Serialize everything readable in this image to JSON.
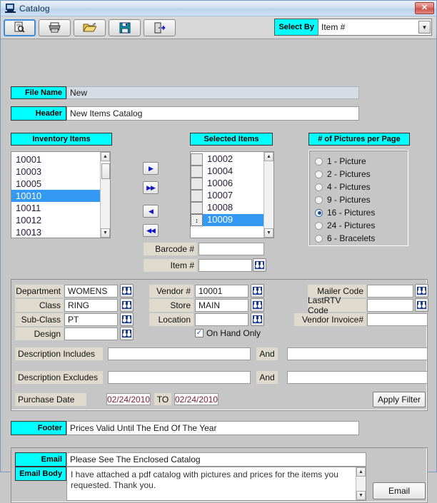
{
  "window": {
    "title": "Catalog",
    "icon": "computer-icon",
    "close_label": "✕"
  },
  "toolbar": {
    "buttons": [
      {
        "name": "print-preview-button",
        "icon": "print-preview-icon"
      },
      {
        "name": "print-button",
        "icon": "printer-icon"
      },
      {
        "name": "open-button",
        "icon": "open-folder-icon"
      },
      {
        "name": "save-button",
        "icon": "floppy-disk-icon"
      },
      {
        "name": "exit-button",
        "icon": "exit-door-icon"
      }
    ],
    "select_by_label": "Select By",
    "select_by_value": "Item #"
  },
  "form": {
    "file_name_label": "File Name",
    "file_name_value": "New",
    "header_label": "Header",
    "header_value": "New Items Catalog"
  },
  "inventory": {
    "title": "Inventory Items",
    "items": [
      "10001",
      "10003",
      "10005",
      "10010",
      "10011",
      "10012",
      "10013"
    ],
    "selected_index": 3
  },
  "selected_items": {
    "title": "Selected Items",
    "items": [
      "10002",
      "10004",
      "10006",
      "10007",
      "10008",
      "10009"
    ],
    "selected_index": 5,
    "handle_glyph": "↕"
  },
  "transfer_buttons": [
    {
      "name": "move-right-button",
      "glyph": "▶"
    },
    {
      "name": "move-all-right-button",
      "glyph": "▶▶"
    },
    {
      "name": "move-left-button",
      "glyph": "◀"
    },
    {
      "name": "move-all-left-button",
      "glyph": "◀◀"
    }
  ],
  "pictures_per_page": {
    "title": "# of Pictures per Page",
    "options": [
      "1 - Picture",
      "2 - Pictures",
      "4 - Pictures",
      "9 - Pictures",
      "16 - Pictures",
      "24 - Pictures",
      "6 - Bracelets"
    ],
    "selected_index": 4
  },
  "lookup": {
    "barcode_label": "Barcode #",
    "barcode_value": "",
    "item_label": "Item #",
    "item_value": ""
  },
  "filter": {
    "department_label": "Department",
    "department_value": "WOMENS",
    "class_label": "Class",
    "class_value": "RING",
    "subclass_label": "Sub-Class",
    "subclass_value": "PT",
    "design_label": "Design",
    "design_value": "",
    "vendor_label": "Vendor #",
    "vendor_value": "10001",
    "store_label": "Store",
    "store_value": "MAIN",
    "location_label": "Location",
    "location_value": "",
    "on_hand_only_label": "On Hand Only",
    "on_hand_only_checked": true,
    "mailer_code_label": "Mailer Code",
    "mailer_code_value": "",
    "lastrtv_code_label": "LastRTV Code",
    "lastrtv_code_value": "",
    "vendor_invoice_label": "Vendor Invoice#",
    "vendor_invoice_value": "",
    "desc_includes_label": "Description Includes",
    "desc_includes_value": "",
    "desc_includes_and_label": "And",
    "desc_includes_value2": "",
    "desc_excludes_label": "Description Excludes",
    "desc_excludes_value": "",
    "desc_excludes_and_label": "And",
    "desc_excludes_value2": "",
    "purchase_date_label": "Purchase Date",
    "purchase_date_from": "02/24/2010",
    "purchase_date_to_label": "TO",
    "purchase_date_to": "02/24/2010",
    "apply_filter_label": "Apply Filter"
  },
  "footer": {
    "label": "Footer",
    "value": "Prices Valid Until The End Of The Year"
  },
  "email": {
    "subject_label": "Email",
    "subject_value": "Please See The Enclosed Catalog",
    "body_label": "Email Body",
    "body_value": "I have attached a pdf catalog with pictures and prices for the items you requested. Thank you.",
    "button_label": "Email"
  },
  "colors": {
    "accent_cyan": "#00ffff",
    "selection_blue": "#3399f3",
    "date_text": "#7a1b3c",
    "window_bg": "#c6c6c6"
  }
}
